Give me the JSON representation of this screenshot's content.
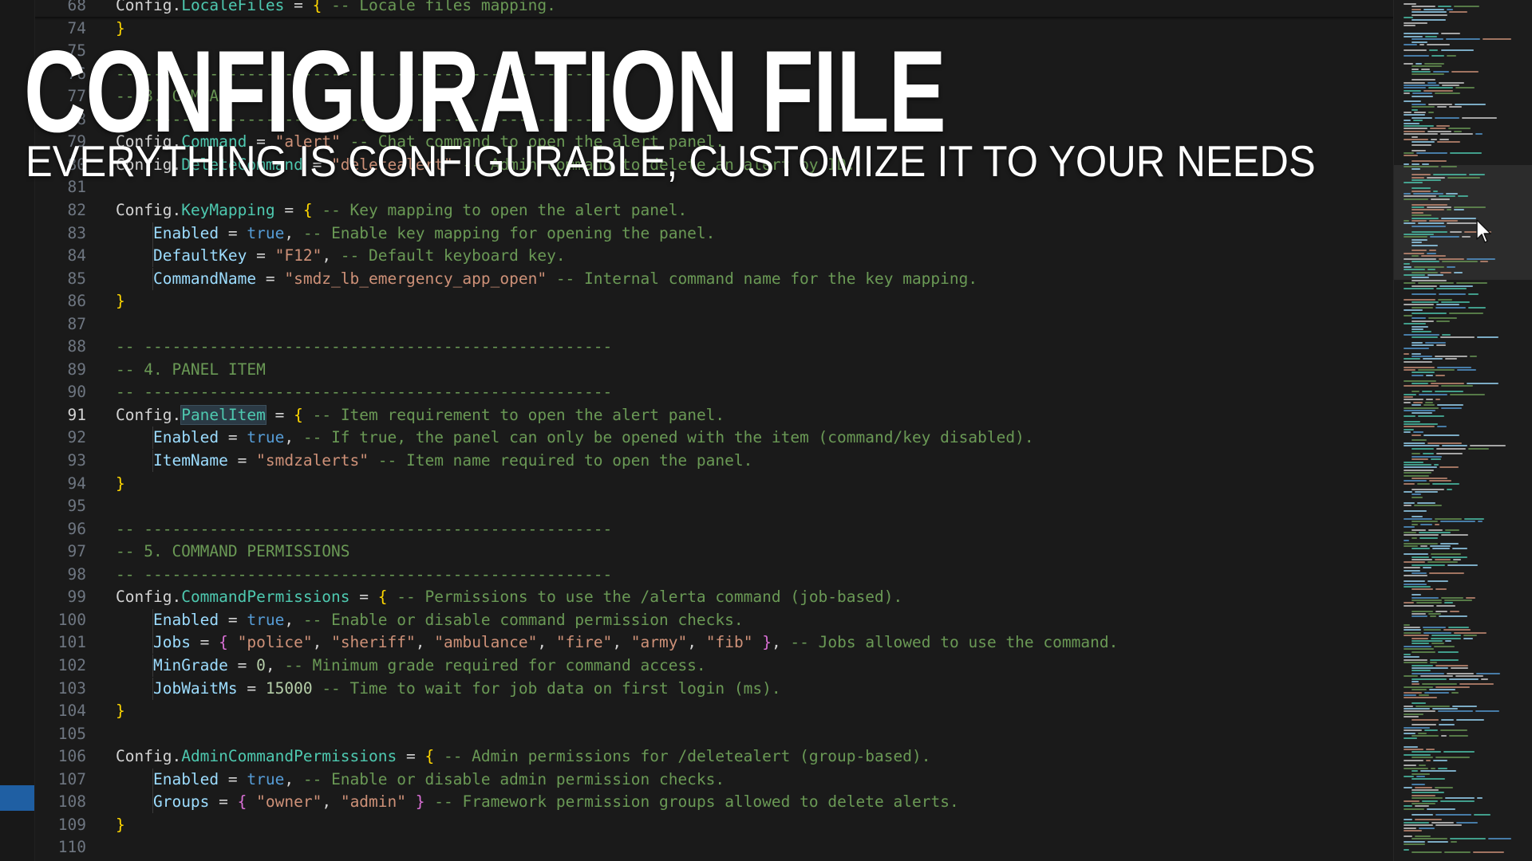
{
  "overlay": {
    "title": "CONFIGURATION FILE",
    "subtitle": "EVERYTHING IS CONFIGURABLE, CUSTOMIZE IT TO YOUR NEEDS"
  },
  "editor": {
    "active_line": "91",
    "lines": [
      {
        "n": "68",
        "tokens": [
          {
            "c": "t-ident",
            "t": "Config"
          },
          {
            "c": "t-punc",
            "t": "."
          },
          {
            "c": "t-member",
            "t": "LocaleFiles"
          },
          {
            "c": "t-punc",
            "t": " = "
          },
          {
            "c": "t-br1",
            "t": "{"
          },
          {
            "c": "t-cmt",
            "t": " -- Locale files mapping."
          }
        ]
      },
      {
        "n": "74",
        "tokens": [
          {
            "c": "t-br1",
            "t": "}"
          }
        ]
      },
      {
        "n": "75",
        "tokens": []
      },
      {
        "n": "76",
        "tokens": [
          {
            "c": "t-cmt",
            "t": "-- --------------------------------------------------"
          }
        ]
      },
      {
        "n": "77",
        "tokens": [
          {
            "c": "t-cmt",
            "t": "-- 3. COMMAND"
          }
        ]
      },
      {
        "n": "78",
        "tokens": [
          {
            "c": "t-cmt",
            "t": "-- --------------------------------------------------"
          }
        ]
      },
      {
        "n": "79",
        "tokens": [
          {
            "c": "t-ident",
            "t": "Config"
          },
          {
            "c": "t-punc",
            "t": "."
          },
          {
            "c": "t-member",
            "t": "Command"
          },
          {
            "c": "t-punc",
            "t": " = "
          },
          {
            "c": "t-str",
            "t": "\"alert\""
          },
          {
            "c": "t-cmt",
            "t": " -- Chat command to open the alert panel."
          }
        ]
      },
      {
        "n": "80",
        "tokens": [
          {
            "c": "t-ident",
            "t": "Config"
          },
          {
            "c": "t-punc",
            "t": "."
          },
          {
            "c": "t-member",
            "t": "DeleteCommand"
          },
          {
            "c": "t-punc",
            "t": " = "
          },
          {
            "c": "t-str",
            "t": "\"deletealert\""
          },
          {
            "c": "t-cmt",
            "t": " -- Admin command to delete an alert by ID."
          }
        ]
      },
      {
        "n": "81",
        "tokens": []
      },
      {
        "n": "82",
        "tokens": [
          {
            "c": "t-ident",
            "t": "Config"
          },
          {
            "c": "t-punc",
            "t": "."
          },
          {
            "c": "t-member",
            "t": "KeyMapping"
          },
          {
            "c": "t-punc",
            "t": " = "
          },
          {
            "c": "t-br1",
            "t": "{"
          },
          {
            "c": "t-cmt",
            "t": " -- Key mapping to open the alert panel."
          }
        ]
      },
      {
        "n": "83",
        "guide": true,
        "tokens": [
          {
            "c": "t-punc",
            "t": "    "
          },
          {
            "c": "t-prop",
            "t": "Enabled"
          },
          {
            "c": "t-punc",
            "t": " = "
          },
          {
            "c": "t-bool",
            "t": "true"
          },
          {
            "c": "t-punc",
            "t": ", "
          },
          {
            "c": "t-cmt",
            "t": "-- Enable key mapping for opening the panel."
          }
        ]
      },
      {
        "n": "84",
        "guide": true,
        "tokens": [
          {
            "c": "t-punc",
            "t": "    "
          },
          {
            "c": "t-prop",
            "t": "DefaultKey"
          },
          {
            "c": "t-punc",
            "t": " = "
          },
          {
            "c": "t-str",
            "t": "\"F12\""
          },
          {
            "c": "t-punc",
            "t": ", "
          },
          {
            "c": "t-cmt",
            "t": "-- Default keyboard key."
          }
        ]
      },
      {
        "n": "85",
        "guide": true,
        "tokens": [
          {
            "c": "t-punc",
            "t": "    "
          },
          {
            "c": "t-prop",
            "t": "CommandName"
          },
          {
            "c": "t-punc",
            "t": " = "
          },
          {
            "c": "t-str",
            "t": "\"smdz_lb_emergency_app_open\""
          },
          {
            "c": "t-cmt",
            "t": " -- Internal command name for the key mapping."
          }
        ]
      },
      {
        "n": "86",
        "tokens": [
          {
            "c": "t-br1",
            "t": "}"
          }
        ]
      },
      {
        "n": "87",
        "tokens": []
      },
      {
        "n": "88",
        "tokens": [
          {
            "c": "t-cmt",
            "t": "-- --------------------------------------------------"
          }
        ]
      },
      {
        "n": "89",
        "tokens": [
          {
            "c": "t-cmt",
            "t": "-- 4. PANEL ITEM"
          }
        ]
      },
      {
        "n": "90",
        "tokens": [
          {
            "c": "t-cmt",
            "t": "-- --------------------------------------------------"
          }
        ]
      },
      {
        "n": "91",
        "tokens": [
          {
            "c": "t-ident",
            "t": "Config"
          },
          {
            "c": "t-punc",
            "t": "."
          },
          {
            "c": "t-member hl",
            "t": "PanelItem"
          },
          {
            "c": "t-punc",
            "t": " = "
          },
          {
            "c": "t-br1",
            "t": "{"
          },
          {
            "c": "t-cmt",
            "t": " -- Item requirement to open the alert panel."
          }
        ]
      },
      {
        "n": "92",
        "guide": true,
        "tokens": [
          {
            "c": "t-punc",
            "t": "    "
          },
          {
            "c": "t-prop",
            "t": "Enabled"
          },
          {
            "c": "t-punc",
            "t": " = "
          },
          {
            "c": "t-bool",
            "t": "true"
          },
          {
            "c": "t-punc",
            "t": ", "
          },
          {
            "c": "t-cmt",
            "t": "-- If true, the panel can only be opened with the item (command/key disabled)."
          }
        ]
      },
      {
        "n": "93",
        "guide": true,
        "tokens": [
          {
            "c": "t-punc",
            "t": "    "
          },
          {
            "c": "t-prop",
            "t": "ItemName"
          },
          {
            "c": "t-punc",
            "t": " = "
          },
          {
            "c": "t-str",
            "t": "\"smdzalerts\""
          },
          {
            "c": "t-cmt",
            "t": " -- Item name required to open the panel."
          }
        ]
      },
      {
        "n": "94",
        "tokens": [
          {
            "c": "t-br1",
            "t": "}"
          }
        ]
      },
      {
        "n": "95",
        "tokens": []
      },
      {
        "n": "96",
        "tokens": [
          {
            "c": "t-cmt",
            "t": "-- --------------------------------------------------"
          }
        ]
      },
      {
        "n": "97",
        "tokens": [
          {
            "c": "t-cmt",
            "t": "-- 5. COMMAND PERMISSIONS"
          }
        ]
      },
      {
        "n": "98",
        "tokens": [
          {
            "c": "t-cmt",
            "t": "-- --------------------------------------------------"
          }
        ]
      },
      {
        "n": "99",
        "tokens": [
          {
            "c": "t-ident",
            "t": "Config"
          },
          {
            "c": "t-punc",
            "t": "."
          },
          {
            "c": "t-member",
            "t": "CommandPermissions"
          },
          {
            "c": "t-punc",
            "t": " = "
          },
          {
            "c": "t-br1",
            "t": "{"
          },
          {
            "c": "t-cmt",
            "t": " -- Permissions to use the /alerta command (job-based)."
          }
        ]
      },
      {
        "n": "100",
        "guide": true,
        "tokens": [
          {
            "c": "t-punc",
            "t": "    "
          },
          {
            "c": "t-prop",
            "t": "Enabled"
          },
          {
            "c": "t-punc",
            "t": " = "
          },
          {
            "c": "t-bool",
            "t": "true"
          },
          {
            "c": "t-punc",
            "t": ", "
          },
          {
            "c": "t-cmt",
            "t": "-- Enable or disable command permission checks."
          }
        ]
      },
      {
        "n": "101",
        "guide": true,
        "tokens": [
          {
            "c": "t-punc",
            "t": "    "
          },
          {
            "c": "t-prop",
            "t": "Jobs"
          },
          {
            "c": "t-punc",
            "t": " = "
          },
          {
            "c": "t-br2",
            "t": "{"
          },
          {
            "c": "t-punc",
            "t": " "
          },
          {
            "c": "t-str",
            "t": "\"police\""
          },
          {
            "c": "t-punc",
            "t": ", "
          },
          {
            "c": "t-str",
            "t": "\"sheriff\""
          },
          {
            "c": "t-punc",
            "t": ", "
          },
          {
            "c": "t-str",
            "t": "\"ambulance\""
          },
          {
            "c": "t-punc",
            "t": ", "
          },
          {
            "c": "t-str",
            "t": "\"fire\""
          },
          {
            "c": "t-punc",
            "t": ", "
          },
          {
            "c": "t-str",
            "t": "\"army\""
          },
          {
            "c": "t-punc",
            "t": ", "
          },
          {
            "c": "t-str",
            "t": "\"fib\""
          },
          {
            "c": "t-punc",
            "t": " "
          },
          {
            "c": "t-br2",
            "t": "}"
          },
          {
            "c": "t-punc",
            "t": ", "
          },
          {
            "c": "t-cmt",
            "t": "-- Jobs allowed to use the command."
          }
        ]
      },
      {
        "n": "102",
        "guide": true,
        "tokens": [
          {
            "c": "t-punc",
            "t": "    "
          },
          {
            "c": "t-prop",
            "t": "MinGrade"
          },
          {
            "c": "t-punc",
            "t": " = "
          },
          {
            "c": "t-num",
            "t": "0"
          },
          {
            "c": "t-punc",
            "t": ", "
          },
          {
            "c": "t-cmt",
            "t": "-- Minimum grade required for command access."
          }
        ]
      },
      {
        "n": "103",
        "guide": true,
        "tokens": [
          {
            "c": "t-punc",
            "t": "    "
          },
          {
            "c": "t-prop",
            "t": "JobWaitMs"
          },
          {
            "c": "t-punc",
            "t": " = "
          },
          {
            "c": "t-num",
            "t": "15000"
          },
          {
            "c": "t-cmt",
            "t": " -- Time to wait for job data on first login (ms)."
          }
        ]
      },
      {
        "n": "104",
        "tokens": [
          {
            "c": "t-br1",
            "t": "}"
          }
        ]
      },
      {
        "n": "105",
        "tokens": []
      },
      {
        "n": "106",
        "tokens": [
          {
            "c": "t-ident",
            "t": "Config"
          },
          {
            "c": "t-punc",
            "t": "."
          },
          {
            "c": "t-member",
            "t": "AdminCommandPermissions"
          },
          {
            "c": "t-punc",
            "t": " = "
          },
          {
            "c": "t-br1",
            "t": "{"
          },
          {
            "c": "t-cmt",
            "t": " -- Admin permissions for /deletealert (group-based)."
          }
        ]
      },
      {
        "n": "107",
        "guide": true,
        "tokens": [
          {
            "c": "t-punc",
            "t": "    "
          },
          {
            "c": "t-prop",
            "t": "Enabled"
          },
          {
            "c": "t-punc",
            "t": " = "
          },
          {
            "c": "t-bool",
            "t": "true"
          },
          {
            "c": "t-punc",
            "t": ", "
          },
          {
            "c": "t-cmt",
            "t": "-- Enable or disable admin permission checks."
          }
        ]
      },
      {
        "n": "108",
        "guide": true,
        "tokens": [
          {
            "c": "t-punc",
            "t": "    "
          },
          {
            "c": "t-prop",
            "t": "Groups"
          },
          {
            "c": "t-punc",
            "t": " = "
          },
          {
            "c": "t-br2",
            "t": "{"
          },
          {
            "c": "t-punc",
            "t": " "
          },
          {
            "c": "t-str",
            "t": "\"owner\""
          },
          {
            "c": "t-punc",
            "t": ", "
          },
          {
            "c": "t-str",
            "t": "\"admin\""
          },
          {
            "c": "t-punc",
            "t": " "
          },
          {
            "c": "t-br2",
            "t": "}"
          },
          {
            "c": "t-cmt",
            "t": " -- Framework permission groups allowed to delete alerts."
          }
        ]
      },
      {
        "n": "109",
        "tokens": [
          {
            "c": "t-br1",
            "t": "}"
          }
        ]
      },
      {
        "n": "110",
        "tokens": []
      }
    ]
  },
  "icons": {
    "cursor": "mouse-pointer-icon"
  }
}
